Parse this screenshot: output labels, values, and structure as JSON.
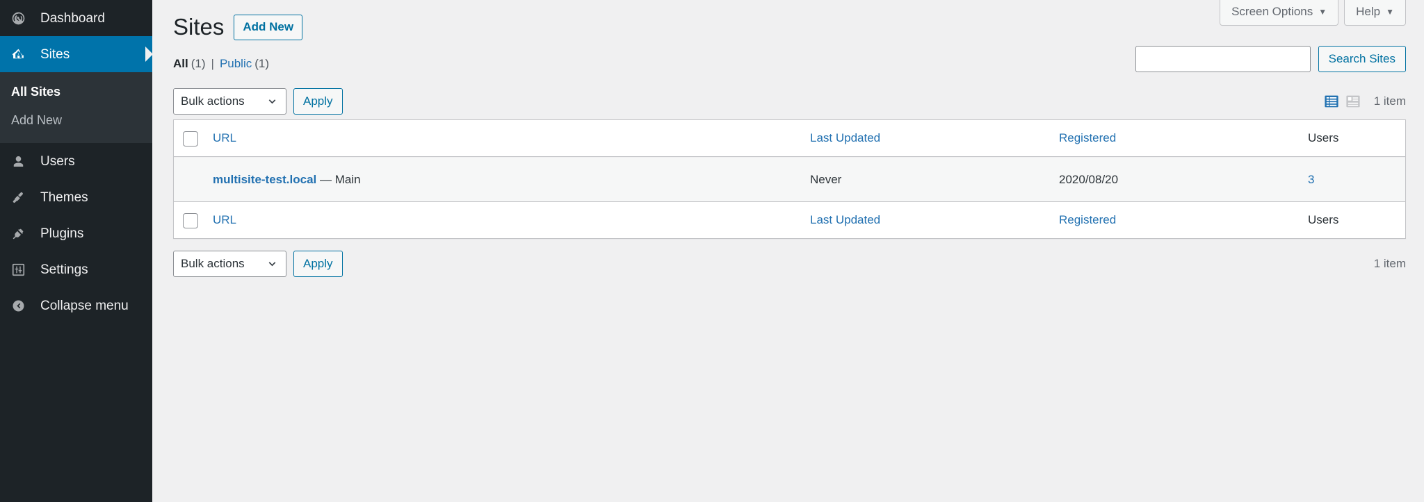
{
  "sidebar": {
    "items": [
      {
        "label": "Dashboard",
        "icon": "dashboard-icon",
        "current": false
      },
      {
        "label": "Sites",
        "icon": "sites-icon",
        "current": true
      },
      {
        "label": "Users",
        "icon": "users-icon",
        "current": false
      },
      {
        "label": "Themes",
        "icon": "themes-icon",
        "current": false
      },
      {
        "label": "Plugins",
        "icon": "plugins-icon",
        "current": false
      },
      {
        "label": "Settings",
        "icon": "settings-icon",
        "current": false
      },
      {
        "label": "Collapse menu",
        "icon": "collapse-icon",
        "current": false
      }
    ],
    "submenu": [
      {
        "label": "All Sites",
        "current": true
      },
      {
        "label": "Add New",
        "current": false
      }
    ]
  },
  "screen_meta": {
    "screen_options": "Screen Options",
    "help": "Help",
    "caret": "▼"
  },
  "header": {
    "title": "Sites",
    "add_new": "Add New"
  },
  "filters": {
    "divider": "|",
    "links": [
      {
        "label": "All",
        "count": "(1)",
        "current": true
      },
      {
        "label": "Public",
        "count": "(1)",
        "current": false
      }
    ]
  },
  "search": {
    "value": "",
    "placeholder": "",
    "button": "Search Sites"
  },
  "tablenav_top": {
    "bulk_actions": "Bulk actions",
    "apply": "Apply",
    "displaying_num": "1 item",
    "view_list": "list-view-icon",
    "view_excerpt": "excerpt-view-icon"
  },
  "tablenav_bottom": {
    "bulk_actions": "Bulk actions",
    "apply": "Apply",
    "displaying_num": "1 item"
  },
  "table": {
    "columns": {
      "url": "URL",
      "last_updated": "Last Updated",
      "registered": "Registered",
      "users": "Users"
    },
    "rows": [
      {
        "url": "multisite-test.local",
        "suffix": "— Main",
        "last_updated": "Never",
        "registered": "2020/08/20",
        "users": "3"
      }
    ]
  },
  "colors": {
    "menu_bg": "#1d2327",
    "submenu_bg": "#2c3338",
    "accent_blue": "#0073aa",
    "link_blue": "#2271b1",
    "button_blue": "#0071a1",
    "body_bg": "#f0f0f1",
    "row_bg": "#f6f7f7"
  }
}
